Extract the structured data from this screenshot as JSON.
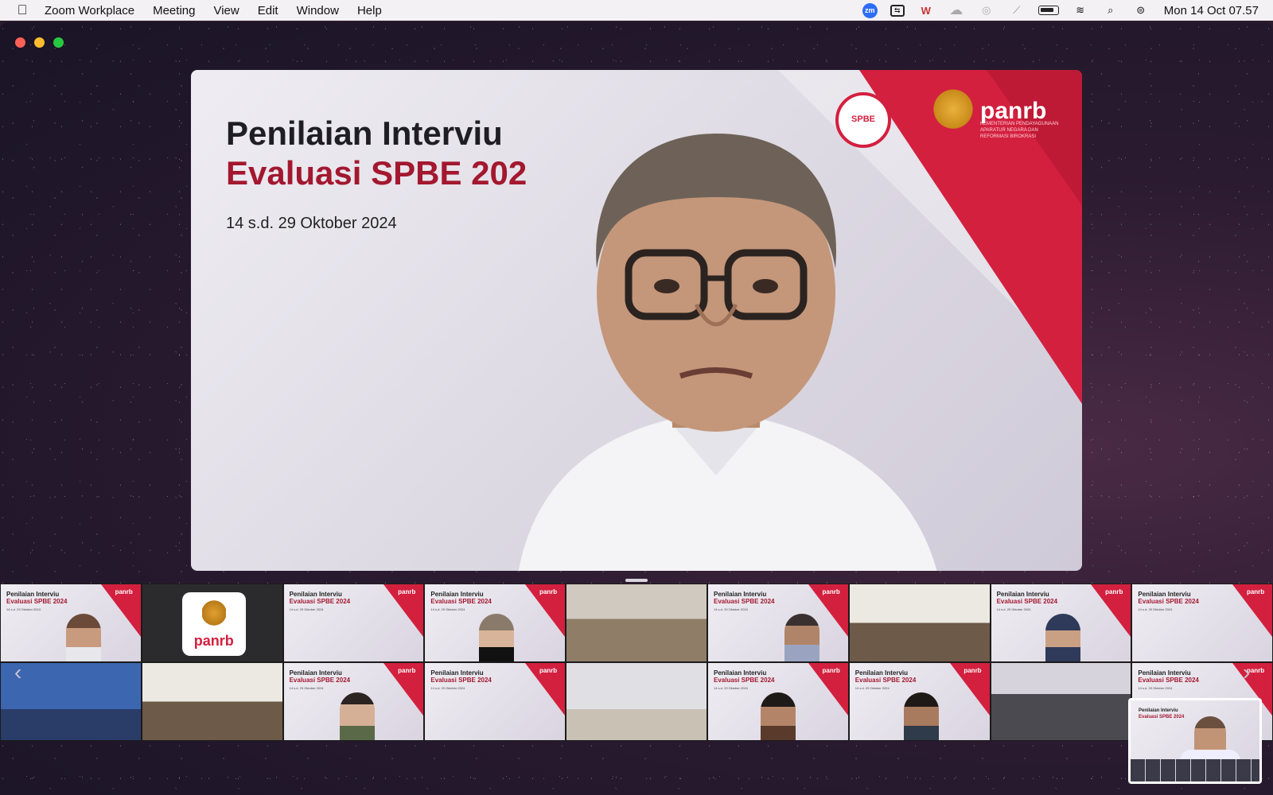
{
  "menubar": {
    "apple_icon": "apple-logo",
    "app_name": "Zoom Workplace",
    "items": [
      "Meeting",
      "View",
      "Edit",
      "Window",
      "Help"
    ],
    "status_icons": [
      "zoom-icon",
      "screen-share-icon",
      "wps-icon",
      "cloud-icon",
      "airdrop-icon",
      "mute-icon",
      "battery-icon",
      "wifi-icon",
      "spotlight-icon",
      "control-center-icon"
    ],
    "zoom_badge": "zm",
    "clock": "Mon 14 Oct  07.57"
  },
  "speaker": {
    "slide_title": "Penilaian Interviu",
    "slide_subtitle": "Evaluasi SPBE 202",
    "slide_date": "14 s.d. 29 Oktober 2024",
    "brand": "panrb",
    "brand_tagline": "KEMENTERIAN PENDAYAGUNAAN APARATUR NEGARA DAN REFORMASI BIROKRASI",
    "accent_color": "#d3203f"
  },
  "gallery": {
    "slide_title": "Penilaian Interviu",
    "slide_subtitle": "Evaluasi SPBE 2024",
    "slide_date": "14 s.d. 29 Oktober 2024",
    "brand": "panrb",
    "logo_label": "panrb"
  },
  "selfview": {
    "slide_title": "Penilaian Interviu",
    "slide_subtitle": "Evaluasi SPBE 2024"
  }
}
